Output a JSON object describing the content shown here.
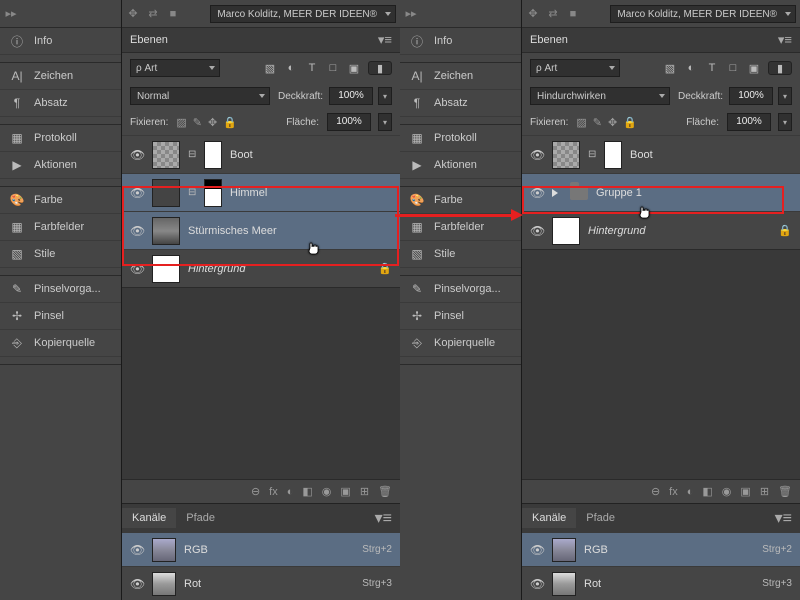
{
  "header": {
    "profile": "Marco Kolditz, MEER DER IDEEN®"
  },
  "sidebar": {
    "items": [
      {
        "label": "Info",
        "icon": "ⓘ"
      },
      {
        "label": "Zeichen",
        "icon": "A|"
      },
      {
        "label": "Absatz",
        "icon": "¶"
      },
      {
        "label": "Protokoll",
        "icon": "▦"
      },
      {
        "label": "Aktionen",
        "icon": "▶"
      },
      {
        "label": "Farbe",
        "icon": "🎨"
      },
      {
        "label": "Farbfelder",
        "icon": "▦"
      },
      {
        "label": "Stile",
        "icon": "▧"
      },
      {
        "label": "Pinselvorga...",
        "icon": "✎"
      },
      {
        "label": "Pinsel",
        "icon": "✢"
      },
      {
        "label": "Kopierquelle",
        "icon": "⎆"
      }
    ]
  },
  "panels": {
    "left": {
      "title": "Ebenen",
      "filter": "Art",
      "blend": "Normal",
      "opacity_label": "Deckkraft:",
      "opacity": "100%",
      "lock_label": "Fixieren:",
      "fill_label": "Fläche:",
      "fill": "100%",
      "layers": [
        {
          "name": "Boot",
          "sel": false,
          "thumb": "check",
          "mask": "white"
        },
        {
          "name": "Himmel",
          "sel": true,
          "thumb": "dark",
          "mask": "half"
        },
        {
          "name": "Stürmisches Meer",
          "sel": true,
          "thumb": "sea"
        },
        {
          "name": "Hintergrund",
          "sel": false,
          "thumb": "white",
          "italic": true,
          "locked": true
        }
      ]
    },
    "right": {
      "title": "Ebenen",
      "filter": "Art",
      "blend": "Hindurchwirken",
      "opacity_label": "Deckkraft:",
      "opacity": "100%",
      "lock_label": "Fixieren:",
      "fill_label": "Fläche:",
      "fill": "100%",
      "layers": [
        {
          "name": "Boot",
          "sel": false,
          "thumb": "check",
          "mask": "white"
        },
        {
          "name": "Gruppe 1",
          "sel": true,
          "group": true
        },
        {
          "name": "Hintergrund",
          "sel": false,
          "thumb": "white",
          "italic": true,
          "locked": true
        }
      ]
    }
  },
  "channels": {
    "tab1": "Kanäle",
    "tab2": "Pfade",
    "items": [
      {
        "name": "RGB",
        "short": "Strg+2"
      },
      {
        "name": "Rot",
        "short": "Strg+3"
      }
    ]
  },
  "footer_icons": [
    "⊖",
    "fx",
    "◐",
    "◧",
    "◉",
    "▣",
    "⊞",
    "🗑"
  ]
}
